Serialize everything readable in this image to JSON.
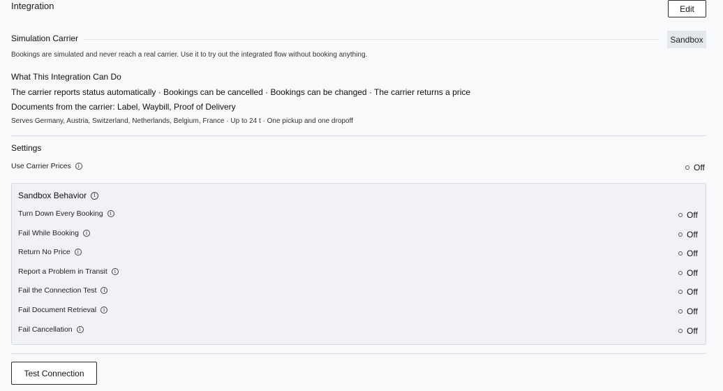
{
  "header": {
    "title": "Integration",
    "edit_label": "Edit"
  },
  "carrier": {
    "name": "Simulation Carrier",
    "badge": "Sandbox",
    "description": "Bookings are simulated and never reach a real carrier. Use it to try out the integrated flow without booking anything."
  },
  "capabilities": {
    "heading": "What This Integration Can Do",
    "features": "The carrier reports status automatically · Bookings can be cancelled · Bookings can be changed · The carrier returns a price",
    "documents": "Documents from the carrier: Label, Waybill, Proof of Delivery",
    "coverage": "Serves Germany, Austria, Switzerland, Netherlands, Belgium, France · Up to 24 t · One pickup and one dropoff"
  },
  "settings": {
    "heading": "Settings",
    "use_carrier_prices": {
      "label": "Use Carrier Prices",
      "value": "Off"
    }
  },
  "sandbox_behavior": {
    "heading": "Sandbox Behavior",
    "items": [
      {
        "label": "Turn Down Every Booking",
        "value": "Off"
      },
      {
        "label": "Fail While Booking",
        "value": "Off"
      },
      {
        "label": "Return No Price",
        "value": "Off"
      },
      {
        "label": "Report a Problem in Transit",
        "value": "Off"
      },
      {
        "label": "Fail the Connection Test",
        "value": "Off"
      },
      {
        "label": "Fail Document Retrieval",
        "value": "Off"
      },
      {
        "label": "Fail Cancellation",
        "value": "Off"
      }
    ]
  },
  "footer": {
    "test_connection_label": "Test Connection"
  },
  "icons": {
    "info": "info-icon",
    "toggle": "radio-off-icon"
  },
  "colors": {
    "page_background": "#f8f9fb",
    "panel_background": "#f0f2f5",
    "badge_background": "#e4e7ec",
    "button_border": "#2b2b2b"
  }
}
